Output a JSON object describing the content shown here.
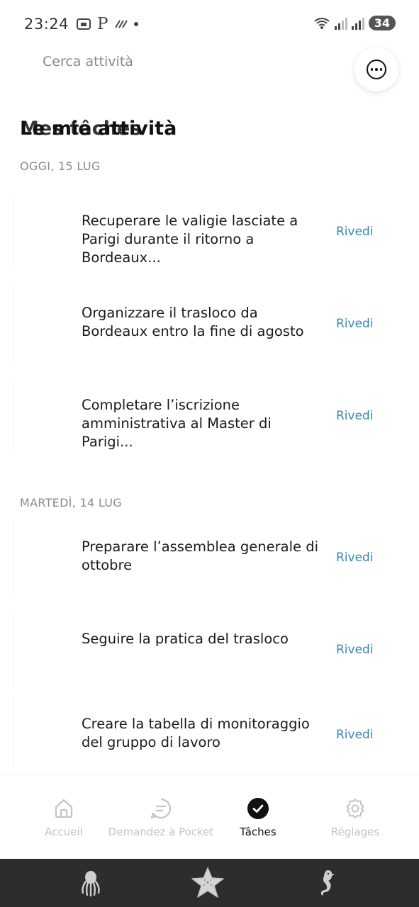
{
  "status": {
    "time": "23:24",
    "battery": "34"
  },
  "search": {
    "placeholder": "Cerca attività"
  },
  "header": {
    "title_primary": "Le mie attività",
    "title_secondary": "Mes tâches"
  },
  "sections": [
    {
      "label": "OGGI, 15 LUG",
      "tasks": [
        {
          "text": "Recuperare le valigie lasciate a Parigi durante il ritorno a Bordeaux...",
          "action": "Rivedi"
        },
        {
          "text": "Organizzare il trasloco da Bordeaux entro la fine di agosto",
          "action": "Rivedi"
        },
        {
          "text": "Completare l’iscrizione amministrativa al Master di Parigi...",
          "action": "Rivedi"
        }
      ]
    },
    {
      "label": "MARTEDÌ, 14 LUG",
      "tasks": [
        {
          "text": "Preparare l’assemblea generale di ottobre",
          "action": "Rivedi"
        },
        {
          "text": "Seguire la pratica del trasloco",
          "action": "Rivedi"
        },
        {
          "text": "Creare la tabella di monitoraggio del gruppo di lavoro",
          "action": "Rivedi"
        }
      ]
    }
  ],
  "nav": [
    {
      "label": "Accueil",
      "icon": "home-icon",
      "active": false
    },
    {
      "label": "Demandez à Pocket",
      "icon": "chat-icon",
      "active": false
    },
    {
      "label": "Tâches",
      "icon": "check-circle-icon",
      "active": true
    },
    {
      "label": "Réglages",
      "icon": "gear-icon",
      "active": false
    }
  ],
  "colors": {
    "accent_link": "#3a86b8",
    "system_bar": "#2d2d2d",
    "inactive_nav": "#c4c4c4"
  }
}
